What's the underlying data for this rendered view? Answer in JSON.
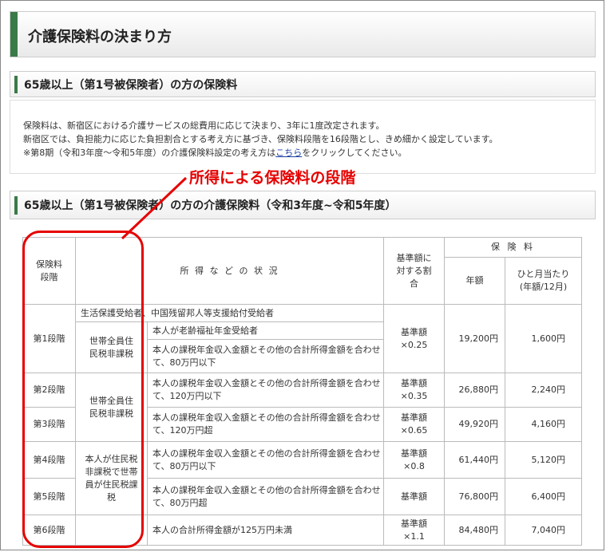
{
  "page_title": "介護保険料の決まり方",
  "section1": {
    "heading": "65歳以上（第1号被保険者）の方の保険料",
    "line1": "保険料は、新宿区における介護サービスの総費用に応じて決まり、3年に1度改定されます。",
    "line2": "新宿区では、負担能力に応じた負担割合とする考え方に基づき、保険料段階を16段階とし、きめ細かく設定しています。",
    "line3_prefix": "※第8期（令和3年度～令和5年度）の介護保険料設定の考え方は",
    "line3_link": "こちら",
    "line3_suffix": "をクリックしてください。"
  },
  "annotation": "所得による保険料の段階",
  "section2": {
    "heading": "65歳以上（第1号被保険者）の方の介護保険料（令和3年度~令和5年度）"
  },
  "table": {
    "headers": {
      "level": "保険料段階",
      "status": "所 得 な ど の 状 況",
      "ratio": "基準額に対する割合",
      "premium": "保 険 料",
      "annual": "年額",
      "monthly": "ひと月当たり(年額/12月)"
    },
    "rows": [
      {
        "level": "第1段階",
        "welfare": "生活保護受給者、中国残留邦人等支援給付受給者",
        "group": "世帯全員住民税非課税",
        "sub1": "本人が老齢福祉年金受給者",
        "sub2": "本人の課税年金収入金額とその他の合計所得金額を合わせて、80万円以下",
        "ratio": "基準額×0.25",
        "annual": "19,200円",
        "monthly": "1,600円"
      },
      {
        "level": "第2段階",
        "group": "世帯全員住民税非課税",
        "status": "本人の課税年金収入金額とその他の合計所得金額を合わせて、120万円以下",
        "ratio": "基準額×0.35",
        "annual": "26,880円",
        "monthly": "2,240円"
      },
      {
        "level": "第3段階",
        "status": "本人の課税年金収入金額とその他の合計所得金額を合わせて、120万円超",
        "ratio": "基準額×0.65",
        "annual": "49,920円",
        "monthly": "4,160円"
      },
      {
        "level": "第4段階",
        "group": "本人が住民税非課税で世帯員が住民税課税",
        "status": "本人の課税年金収入金額とその他の合計所得金額を合わせて、80万円以下",
        "ratio": "基準額×0.8",
        "annual": "61,440円",
        "monthly": "5,120円"
      },
      {
        "level": "第5段階",
        "status": "本人の課税年金収入金額とその他の合計所得金額を合わせて、80万円超",
        "ratio": "基準額",
        "annual": "76,800円",
        "monthly": "6,400円"
      },
      {
        "level": "第6段階",
        "status": "本人の合計所得金額が125万円未満",
        "ratio": "基準額×1.1",
        "annual": "84,480円",
        "monthly": "7,040円"
      }
    ]
  },
  "colors": {
    "accent": "#3a7a47",
    "annotation": "#e60000",
    "link": "#1a3fa0"
  }
}
